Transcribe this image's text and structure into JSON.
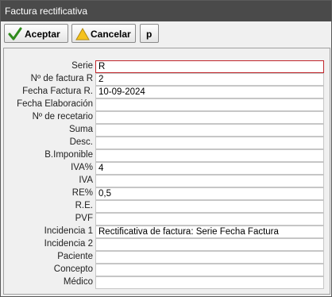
{
  "window": {
    "title": "Factura rectificativa"
  },
  "toolbar": {
    "accept_label": "Aceptar",
    "cancel_label": "Cancelar",
    "p_label": "p"
  },
  "fields": [
    {
      "label": "Serie",
      "value": "R"
    },
    {
      "label": "Nº de factura R",
      "value": "2"
    },
    {
      "label": "Fecha Factura R.",
      "value": "10-09-2024"
    },
    {
      "label": "Fecha Elaboración",
      "value": ""
    },
    {
      "label": "Nº de recetario",
      "value": ""
    },
    {
      "label": "Suma",
      "value": ""
    },
    {
      "label": "Desc.",
      "value": ""
    },
    {
      "label": "B.Imponible",
      "value": ""
    },
    {
      "label": "IVA%",
      "value": " 4"
    },
    {
      "label": "IVA",
      "value": ""
    },
    {
      "label": "RE%",
      "value": " 0,5"
    },
    {
      "label": "R.E.",
      "value": ""
    },
    {
      "label": "PVF",
      "value": ""
    },
    {
      "label": "Incidencia 1",
      "value": "Rectificativa de factura: Serie   Fecha Factura"
    },
    {
      "label": "Incidencia 2",
      "value": ""
    },
    {
      "label": "Paciente",
      "value": ""
    },
    {
      "label": "Concepto",
      "value": ""
    },
    {
      "label": "Médico",
      "value": ""
    }
  ]
}
